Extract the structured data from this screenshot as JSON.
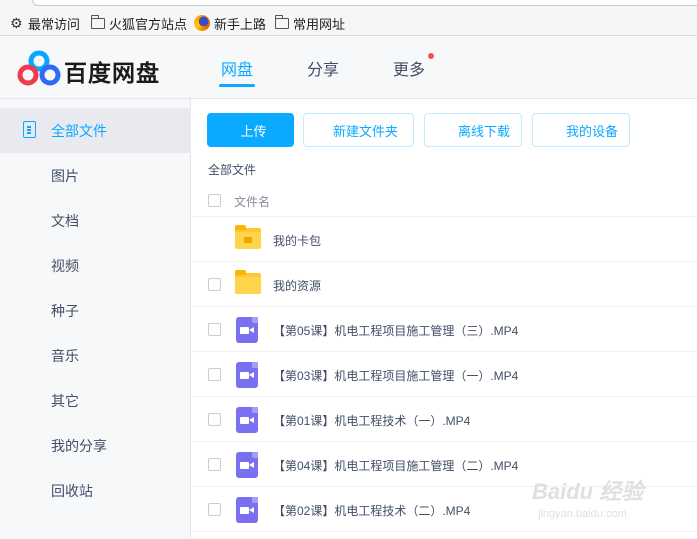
{
  "bookmarks": [
    {
      "label": "最常访问",
      "icon": "gear-icon"
    },
    {
      "label": "火狐官方站点",
      "icon": "folder-icon"
    },
    {
      "label": "新手上路",
      "icon": "firefox-icon"
    },
    {
      "label": "常用网址",
      "icon": "folder-icon"
    }
  ],
  "header": {
    "brand": "百度网盘",
    "nav": [
      {
        "label": "网盘",
        "active": true
      },
      {
        "label": "分享",
        "active": false
      },
      {
        "label": "更多",
        "active": false,
        "has_dot": true
      }
    ]
  },
  "sidebar": {
    "items": [
      {
        "label": "全部文件",
        "active": true
      },
      {
        "label": "图片"
      },
      {
        "label": "文档"
      },
      {
        "label": "视频"
      },
      {
        "label": "种子"
      },
      {
        "label": "音乐"
      },
      {
        "label": "其它"
      },
      {
        "label": "我的分享"
      },
      {
        "label": "回收站"
      }
    ]
  },
  "toolbar": {
    "upload": "上传",
    "new_folder": "新建文件夹",
    "offline_download": "离线下载",
    "my_devices": "我的设备"
  },
  "breadcrumb": "全部文件",
  "list": {
    "column_name": "文件名",
    "rows": [
      {
        "name": "我的卡包",
        "type": "folder-card"
      },
      {
        "name": "我的资源",
        "type": "folder"
      },
      {
        "name": "【第05课】机电工程项目施工管理（三）.MP4",
        "type": "video"
      },
      {
        "name": "【第03课】机电工程项目施工管理（一）.MP4",
        "type": "video"
      },
      {
        "name": "【第01课】机电工程技术（一）.MP4",
        "type": "video"
      },
      {
        "name": "【第04课】机电工程项目施工管理（二）.MP4",
        "type": "video"
      },
      {
        "name": "【第02课】机电工程技术（二）.MP4",
        "type": "video"
      }
    ]
  },
  "watermark": {
    "main": "Baidu 经验",
    "sub": "jingyan.baidu.com"
  },
  "colors": {
    "accent": "#09aaff",
    "sidebar_bg": "#f7f8fa",
    "folder": "#ffc631",
    "video": "#7a6ff0",
    "notify_dot": "#f35050"
  }
}
